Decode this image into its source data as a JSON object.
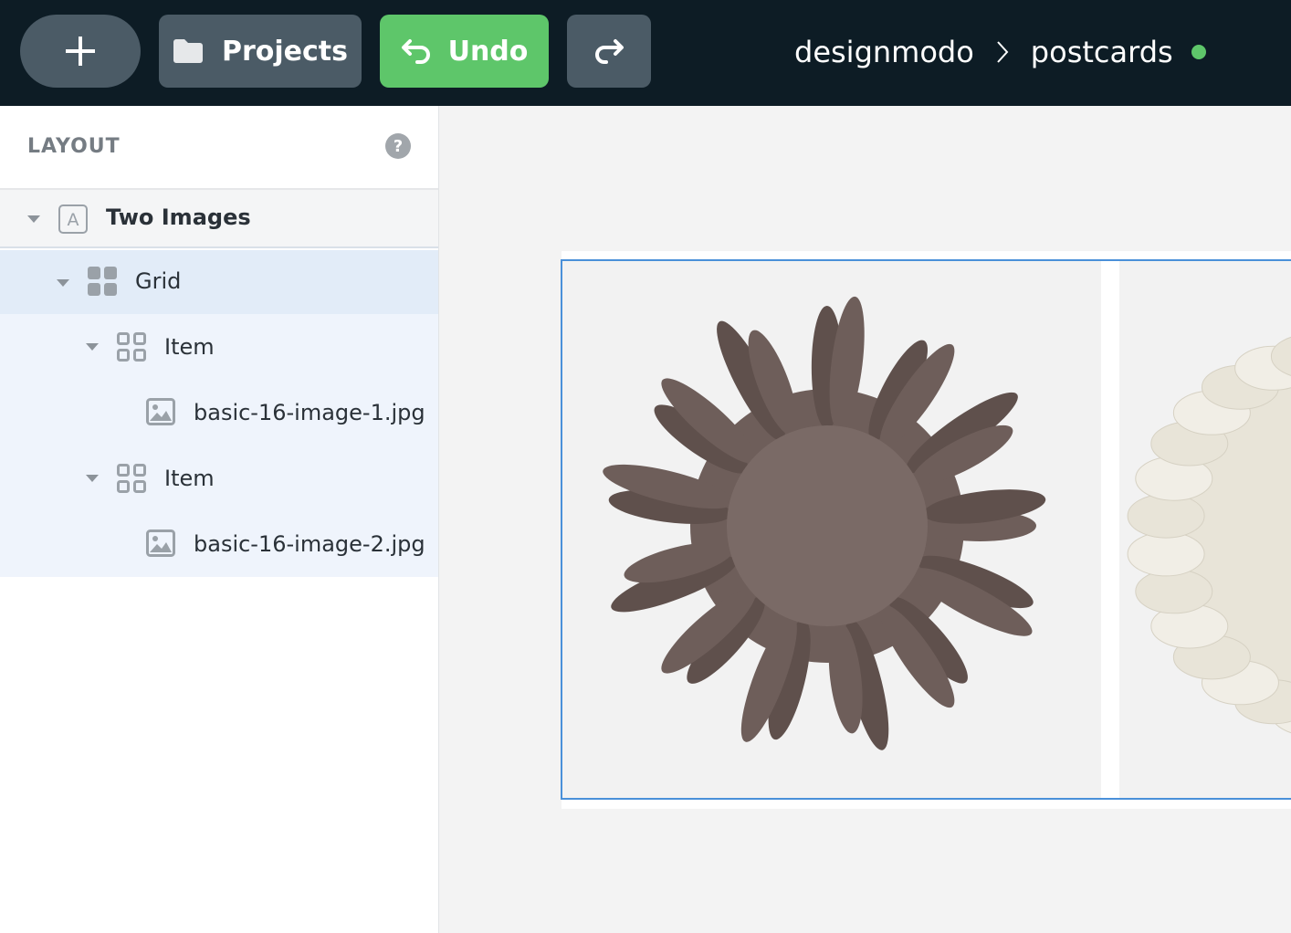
{
  "toolbar": {
    "add_icon": "plus-icon",
    "projects_label": "Projects",
    "projects_icon": "folder-icon",
    "undo_label": "Undo",
    "undo_icon": "undo-arrow-icon",
    "redo_icon": "redo-arrow-icon"
  },
  "breadcrumb": {
    "workspace": "designmodo",
    "separator_icon": "chevron-right-icon",
    "project": "postcards",
    "status_color": "#5ec66a"
  },
  "sidebar": {
    "title": "LAYOUT",
    "help": "?",
    "tree": [
      {
        "label": "Two Images",
        "icon": "text-block-icon"
      },
      {
        "label": "Grid",
        "icon": "grid-filled-icon"
      },
      {
        "label": "Item",
        "icon": "grid-outline-icon"
      },
      {
        "label": "basic-16-image-1.jpg",
        "icon": "image-icon"
      },
      {
        "label": "Item",
        "icon": "grid-outline-icon"
      },
      {
        "label": "basic-16-image-2.jpg",
        "icon": "image-icon"
      }
    ]
  },
  "canvas": {
    "images": [
      {
        "color": "#6e5e5a"
      },
      {
        "color": "#e8e4d8"
      }
    ],
    "selection_color": "#4a90d9"
  }
}
